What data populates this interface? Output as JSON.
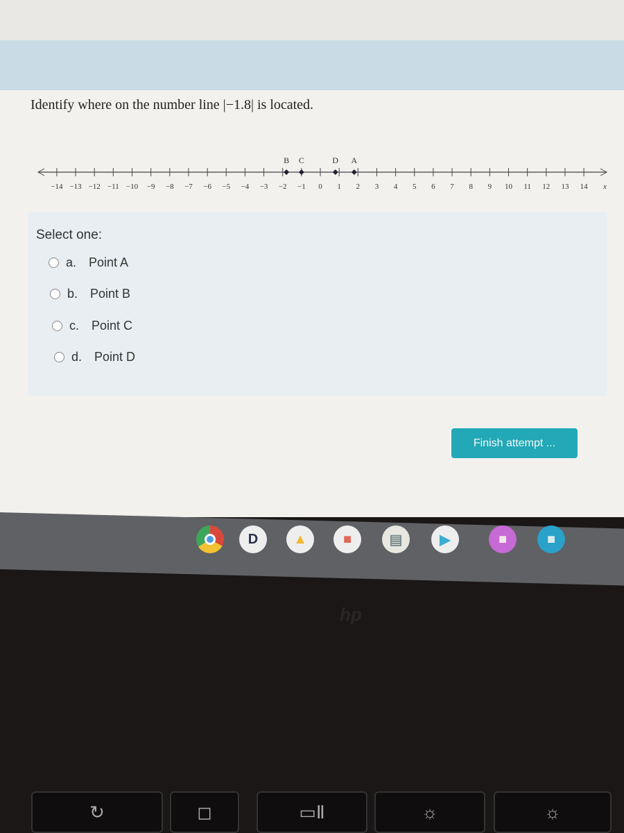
{
  "question": "Identify where on the number line |−1.8| is located.",
  "number_line": {
    "min": -14,
    "max": 14,
    "axis_label": "x",
    "points": [
      {
        "label": "B",
        "value": -1.8
      },
      {
        "label": "C",
        "value": -1
      },
      {
        "label": "D",
        "value": 0.8
      },
      {
        "label": "A",
        "value": 1.8
      }
    ]
  },
  "select_label": "Select one:",
  "options": [
    {
      "letter": "a.",
      "text": "Point A"
    },
    {
      "letter": "b.",
      "text": "Point B"
    },
    {
      "letter": "c.",
      "text": "Point C"
    },
    {
      "letter": "d.",
      "text": "Point D"
    }
  ],
  "finish_button": "Finish attempt ...",
  "shelf_apps": [
    "chrome-icon",
    "docs-d-icon",
    "drive-icon",
    "slides-icon",
    "files-doc-icon",
    "play-icon",
    "notes-icon",
    "folder-icon"
  ],
  "colors": {
    "accent": "#22a8b6",
    "band": "#c9dce6"
  },
  "brand": "hp",
  "docs_letter": "D"
}
